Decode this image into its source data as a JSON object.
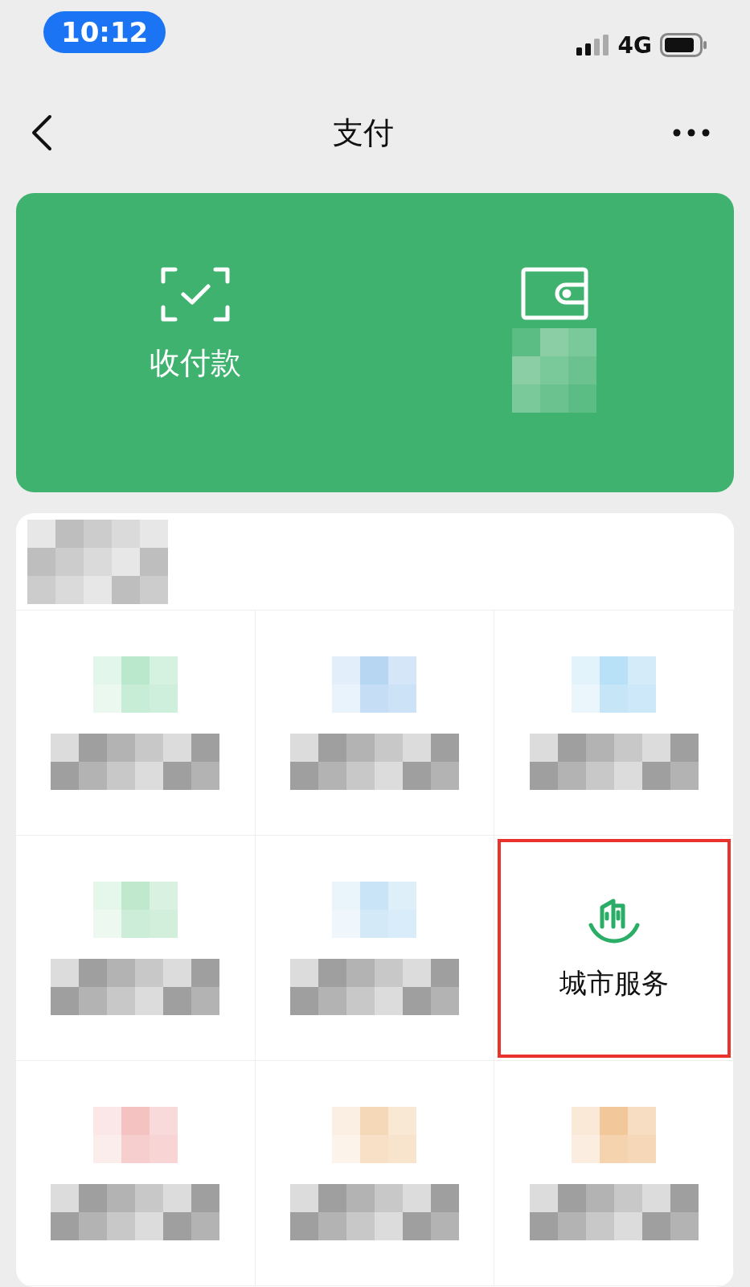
{
  "status_bar": {
    "time": "10:12",
    "network": "4G"
  },
  "nav": {
    "title": "支付"
  },
  "pay_card": {
    "actions": [
      {
        "kind": "scan",
        "label": "收付款"
      },
      {
        "kind": "wallet",
        "label_hidden": true
      }
    ]
  },
  "services": {
    "header_hidden": true,
    "cells": [
      {
        "kind": "pixelated",
        "color": "#b9e8cc"
      },
      {
        "kind": "pixelated",
        "color": "#b7d6f2"
      },
      {
        "kind": "pixelated",
        "color": "#b8e0f6"
      },
      {
        "kind": "pixelated",
        "color": "#bfe8cd"
      },
      {
        "kind": "pixelated",
        "color": "#c9e4f6"
      },
      {
        "kind": "service",
        "label": "城市服务",
        "highlighted": true
      },
      {
        "kind": "pixelated",
        "color": "#f5c2c2"
      },
      {
        "kind": "pixelated",
        "color": "#f5d8b8"
      },
      {
        "kind": "pixelated",
        "color": "#f2c89a"
      }
    ]
  }
}
